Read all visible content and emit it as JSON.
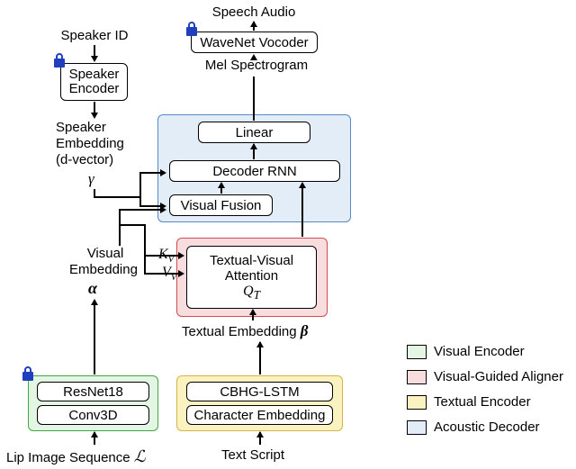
{
  "top": {
    "speech_audio": "Speech Audio",
    "vocoder": "WaveNet Vocoder",
    "mel": "Mel Spectrogram"
  },
  "speaker": {
    "id": "Speaker ID",
    "encoder": "Speaker\nEncoder",
    "embedding_l1": "Speaker",
    "embedding_l2": "Embedding",
    "embedding_l3": "(d-vector)",
    "gamma": "γ"
  },
  "decoder": {
    "linear": "Linear",
    "rnn": "Decoder RNN",
    "fusion": "Visual Fusion"
  },
  "aligner": {
    "title_l1": "Textual-Visual",
    "title_l2": "Attention",
    "qt": "Q",
    "qt_sub": "T",
    "kv": "K",
    "kv_sub": "V",
    "vv": "V",
    "vv_sub": "V"
  },
  "visual": {
    "emb_l1": "Visual",
    "emb_l2": "Embedding",
    "alpha": "α",
    "resnet": "ResNet18",
    "conv3d": "Conv3D"
  },
  "textual": {
    "emb_label_l1": "Textual Embedding",
    "beta": "β",
    "cbhg": "CBHG-LSTM",
    "charemb": "Character Embedding"
  },
  "inputs": {
    "lip_label": "Lip Image Sequence",
    "lip_sym": "ℒ",
    "text_script": "Text Script"
  },
  "legend": {
    "visual_enc": "Visual Encoder",
    "aligner": "Visual-Guided Aligner",
    "textual_enc": "Textual Encoder",
    "acoustic_dec": "Acoustic Decoder"
  }
}
